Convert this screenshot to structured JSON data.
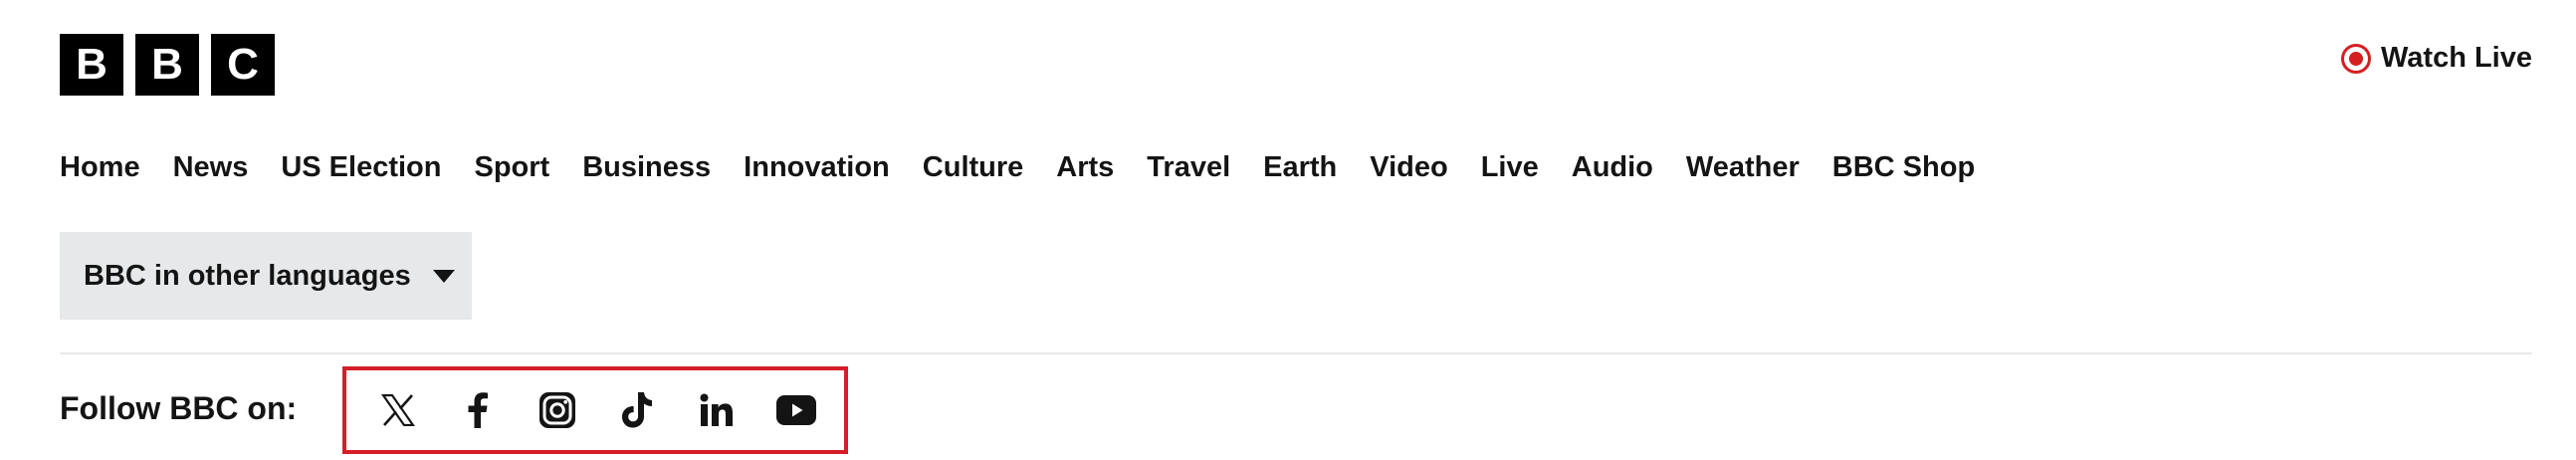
{
  "header": {
    "logo_letters": [
      "B",
      "B",
      "C"
    ],
    "watch_live_label": "Watch Live",
    "live_color": "#d42020"
  },
  "nav": {
    "items": [
      "Home",
      "News",
      "US Election",
      "Sport",
      "Business",
      "Innovation",
      "Culture",
      "Arts",
      "Travel",
      "Earth",
      "Video",
      "Live",
      "Audio",
      "Weather",
      "BBC Shop"
    ]
  },
  "languages": {
    "label": "BBC in other languages",
    "icon": "chevron-down-icon"
  },
  "follow": {
    "label": "Follow BBC on:",
    "highlight_color": "#d51e2a",
    "networks": [
      {
        "name": "x-icon"
      },
      {
        "name": "facebook-icon"
      },
      {
        "name": "instagram-icon"
      },
      {
        "name": "tiktok-icon"
      },
      {
        "name": "linkedin-icon"
      },
      {
        "name": "youtube-icon"
      }
    ]
  }
}
